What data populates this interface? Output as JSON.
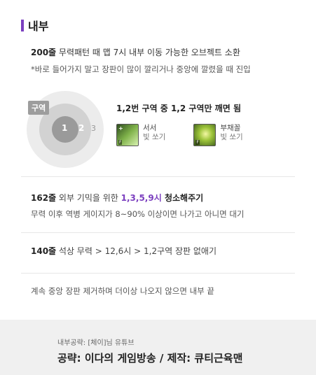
{
  "section": {
    "title": "내부"
  },
  "intro": {
    "num": "200줄",
    "text": " 무력패턴 때 맵 7시 내부 이동 가능한 오브젝트 소환",
    "note": "*바로 들어가지 말고 장판이 많이 깔리거나 중앙에 깔렸을 때 진입"
  },
  "zone": {
    "tag": "구역",
    "labels": [
      "1",
      "2",
      "3"
    ],
    "title": "1,2번 구역 중 1,2 구역만 깨면 됨",
    "skills": [
      {
        "name": "서서",
        "sub": "빛 쏘기",
        "icon": "skill-seoseo-icon"
      },
      {
        "name": "부채꼴",
        "sub": "빛 쏘기",
        "icon": "skill-buchaekkol-icon"
      }
    ]
  },
  "block162": {
    "num": "162줄",
    "pre": " 외부 기믹을 위한 ",
    "hours": "1,3,5,9시",
    "post": " 청소해주기",
    "sub": "무력 이후 역병 게이지가 8~90% 이상이면 나가고 아니면 대기"
  },
  "block140": {
    "num": "140줄",
    "text": " 석상 무력 > 12,6시 > 1,2구역 장판 없애기"
  },
  "closing": {
    "text": "계속 중앙 장판 제거하며 더이상 나오지 않으면 내부 끝"
  },
  "footer": {
    "credit": "내부공략: [체이]님 유튜브",
    "title": "공략: 이다의 게임방송 / 제작: 큐티근육맨"
  },
  "colors": {
    "accent": "#7b3fbf",
    "footer_bg": "#f0f0f0"
  }
}
